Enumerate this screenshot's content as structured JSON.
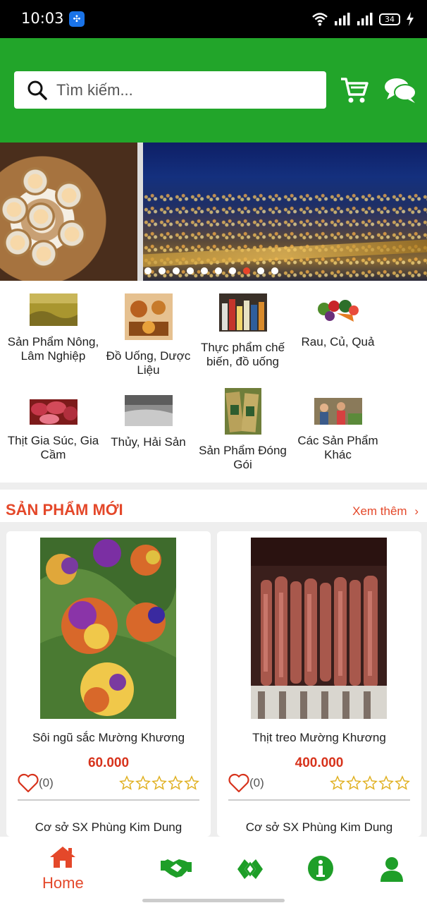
{
  "status_bar": {
    "time": "10:03",
    "battery": "34"
  },
  "header": {
    "search_placeholder": "Tìm kiếm..."
  },
  "banner": {
    "slide_count": 10,
    "active_index": 7
  },
  "categories": [
    {
      "label": "Sản Phẩm Nông, Lâm Nghiệp"
    },
    {
      "label": "Đồ Uống, Dược Liệu"
    },
    {
      "label": "Thực phẩm chế biến, đồ uống"
    },
    {
      "label": "Rau, Củ, Quả"
    },
    {
      "label": "Thịt Gia Súc, Gia Cầm"
    },
    {
      "label": "Thủy, Hải Sản"
    },
    {
      "label": "Sản Phẩm Đóng Gói"
    },
    {
      "label": "Các Sản Phẩm Khác"
    }
  ],
  "new_products": {
    "title": "SẢN PHẨM MỚI",
    "see_more": "Xem thêm",
    "items": [
      {
        "name": "Sôi ngũ sắc Mường Khương",
        "price": "60.000",
        "likes": "(0)",
        "rating": 0,
        "seller": "Cơ sở SX Phùng Kim Dung"
      },
      {
        "name": "Thịt treo Mường Khương",
        "price": "400.000",
        "likes": "(0)",
        "rating": 0,
        "seller": "Cơ sở SX Phùng Kim Dung"
      }
    ]
  },
  "bottom_nav": {
    "home_label": "Home",
    "active_color": "#e4482a",
    "icon_color": "#1e9e28"
  },
  "colors": {
    "header_green": "#22a52a",
    "accent_red": "#e4482a",
    "price_red": "#d7331c"
  }
}
